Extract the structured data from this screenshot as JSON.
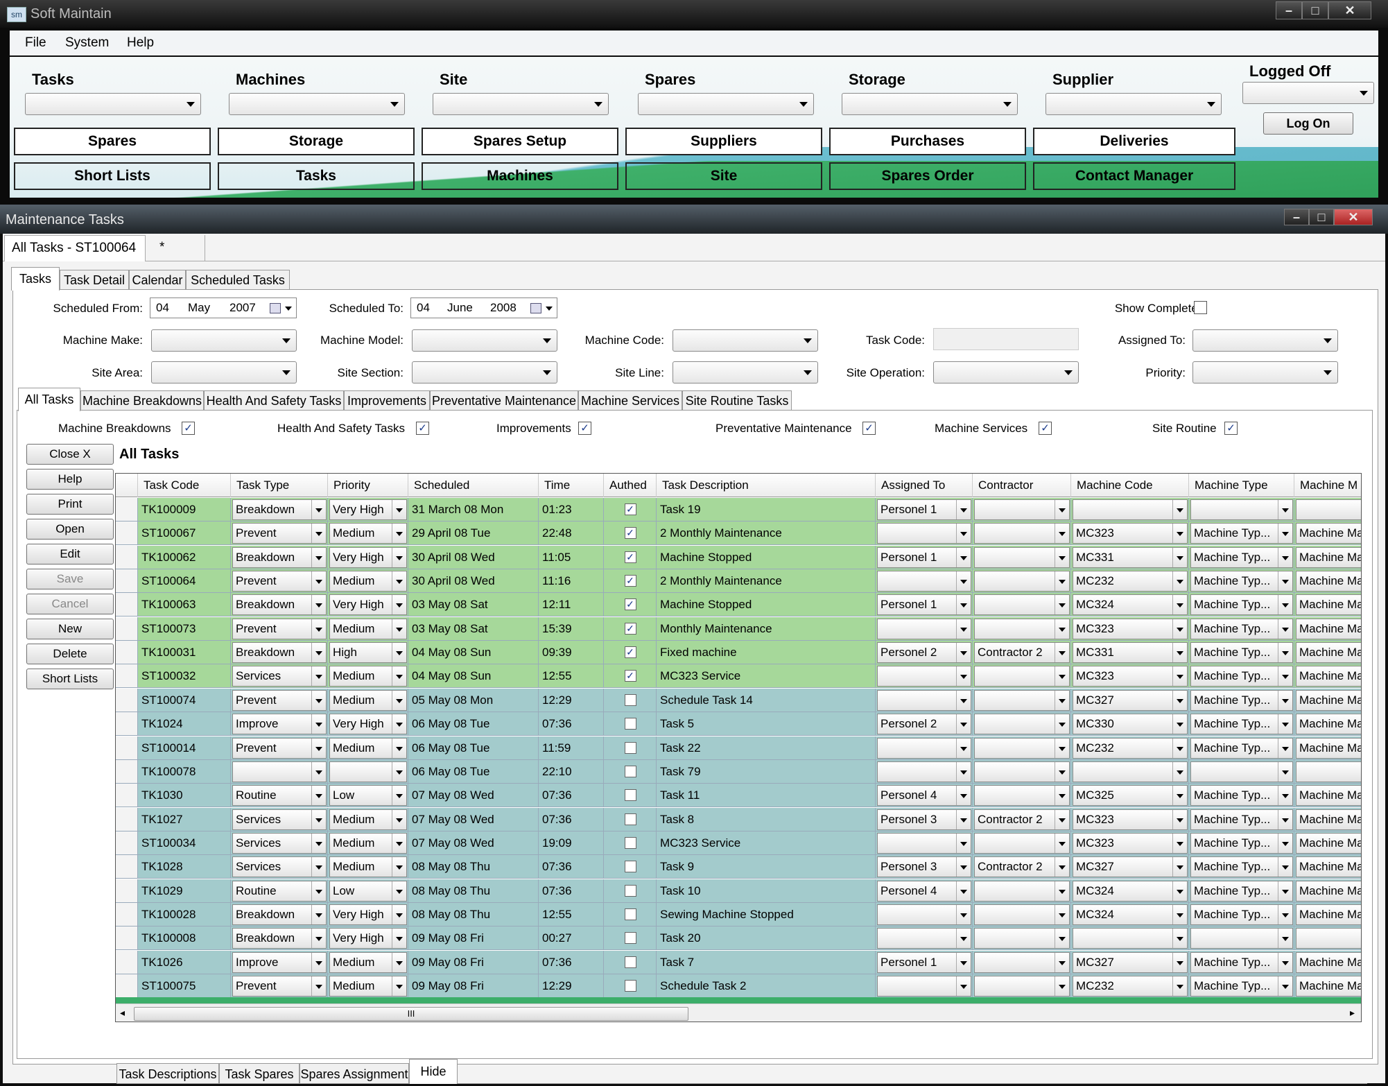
{
  "app": {
    "title": "Soft Maintain",
    "logo_text": "sm"
  },
  "menu": [
    "File",
    "System",
    "Help"
  ],
  "top_dropdowns": [
    {
      "label": "Tasks"
    },
    {
      "label": "Machines"
    },
    {
      "label": "Site"
    },
    {
      "label": "Spares"
    },
    {
      "label": "Storage"
    },
    {
      "label": "Supplier"
    }
  ],
  "login": {
    "status": "Logged Off",
    "button": "Log On"
  },
  "nav_row1": [
    "Spares",
    "Storage",
    "Spares Setup",
    "Suppliers",
    "Purchases",
    "Deliveries"
  ],
  "nav_row2": [
    "Short Lists",
    "Tasks",
    "Machines",
    "Site",
    "Spares Order",
    "Contact Manager"
  ],
  "window": {
    "title": "Maintenance Tasks"
  },
  "doc_tabs": [
    "All Tasks - ST100064",
    "*"
  ],
  "main_tabs": [
    "Tasks",
    "Task Detail",
    "Calendar",
    "Scheduled Tasks"
  ],
  "filters": {
    "scheduled_from": {
      "label": "Scheduled From:",
      "day": "04",
      "month": "May",
      "year": "2007"
    },
    "scheduled_to": {
      "label": "Scheduled To:",
      "day": "04",
      "month": "June",
      "year": "2008"
    },
    "show_completed": "Show Completed:",
    "machine_make": "Machine Make:",
    "machine_model": "Machine Model:",
    "machine_code": "Machine Code:",
    "task_code": "Task Code:",
    "assigned_to": "Assigned To:",
    "site_area": "Site Area:",
    "site_section": "Site Section:",
    "site_line": "Site Line:",
    "site_operation": "Site Operation:",
    "priority": "Priority:"
  },
  "task_tabs": [
    "All Tasks",
    "Machine Breakdowns",
    "Health And Safety Tasks",
    "Improvements",
    "Preventative Maintenance",
    "Machine Services",
    "Site Routine Tasks"
  ],
  "type_checks": [
    "Machine Breakdowns",
    "Health And Safety Tasks",
    "Improvements",
    "Preventative Maintenance",
    "Machine Services",
    "Site Routine"
  ],
  "side_buttons": [
    "Close X",
    "Help",
    "Print",
    "Open",
    "Edit",
    "Save",
    "Cancel",
    "New",
    "Delete",
    "Short Lists"
  ],
  "grid_title": "All Tasks",
  "columns": [
    "Task Code",
    "Task Type",
    "Priority",
    "Scheduled",
    "Time",
    "Authed",
    "Task Description",
    "Assigned To",
    "Contractor",
    "Machine Code",
    "Machine Type",
    "Machine M"
  ],
  "rows": [
    {
      "code": "TK100009",
      "type": "Breakdown",
      "priority": "Very High",
      "scheduled": "31 March 08 Mon",
      "time": "01:23",
      "authed": true,
      "desc": "Task 19",
      "assigned": "Personel 1",
      "contractor": "",
      "mcode": "",
      "mtype": "",
      "mm": "",
      "color": "green"
    },
    {
      "code": "ST100067",
      "type": "Prevent",
      "priority": "Medium",
      "scheduled": "29 April 08 Tue",
      "time": "22:48",
      "authed": true,
      "desc": "2 Monthly Maintenance",
      "assigned": "",
      "contractor": "",
      "mcode": "MC323",
      "mtype": "Machine Typ...",
      "mm": "Machine Ma",
      "color": "green"
    },
    {
      "code": "TK100062",
      "type": "Breakdown",
      "priority": "Very High",
      "scheduled": "30 April 08 Wed",
      "time": "11:05",
      "authed": true,
      "desc": "Machine Stopped",
      "assigned": "Personel 1",
      "contractor": "",
      "mcode": "MC331",
      "mtype": "Machine Typ...",
      "mm": "Machine Ma",
      "color": "green"
    },
    {
      "code": "ST100064",
      "type": "Prevent",
      "priority": "Medium",
      "scheduled": "30 April 08 Wed",
      "time": "11:16",
      "authed": true,
      "desc": "2 Monthly Maintenance",
      "assigned": "",
      "contractor": "",
      "mcode": "MC232",
      "mtype": "Machine Typ...",
      "mm": "Machine Ma",
      "color": "green"
    },
    {
      "code": "TK100063",
      "type": "Breakdown",
      "priority": "Very High",
      "scheduled": "03 May 08 Sat",
      "time": "12:11",
      "authed": true,
      "desc": "Machine Stopped",
      "assigned": "Personel 1",
      "contractor": "",
      "mcode": "MC324",
      "mtype": "Machine Typ...",
      "mm": "Machine Ma",
      "color": "green"
    },
    {
      "code": "ST100073",
      "type": "Prevent",
      "priority": "Medium",
      "scheduled": "03 May 08 Sat",
      "time": "15:39",
      "authed": true,
      "desc": "Monthly Maintenance",
      "assigned": "",
      "contractor": "",
      "mcode": "MC323",
      "mtype": "Machine Typ...",
      "mm": "Machine Ma",
      "color": "green"
    },
    {
      "code": "TK100031",
      "type": "Breakdown",
      "priority": "High",
      "scheduled": "04 May 08 Sun",
      "time": "09:39",
      "authed": true,
      "desc": "Fixed machine",
      "assigned": "Personel 2",
      "contractor": "Contractor 2",
      "mcode": "MC331",
      "mtype": "Machine Typ...",
      "mm": "Machine Ma",
      "color": "green"
    },
    {
      "code": "ST100032",
      "type": "Services",
      "priority": "Medium",
      "scheduled": "04 May 08 Sun",
      "time": "12:55",
      "authed": true,
      "desc": "MC323 Service",
      "assigned": "",
      "contractor": "",
      "mcode": "MC323",
      "mtype": "Machine Typ...",
      "mm": "Machine Ma",
      "color": "green"
    },
    {
      "code": "ST100074",
      "type": "Prevent",
      "priority": "Medium",
      "scheduled": "05 May 08 Mon",
      "time": "12:29",
      "authed": false,
      "desc": "Schedule Task 14",
      "assigned": "",
      "contractor": "",
      "mcode": "MC327",
      "mtype": "Machine Typ...",
      "mm": "Machine Ma",
      "color": "blue"
    },
    {
      "code": "TK1024",
      "type": "Improve",
      "priority": "Very High",
      "scheduled": "06 May 08 Tue",
      "time": "07:36",
      "authed": false,
      "desc": "Task 5",
      "assigned": "Personel 2",
      "contractor": "",
      "mcode": "MC330",
      "mtype": "Machine Typ...",
      "mm": "Machine Ma",
      "color": "blue"
    },
    {
      "code": "ST100014",
      "type": "Prevent",
      "priority": "Medium",
      "scheduled": "06 May 08 Tue",
      "time": "11:59",
      "authed": false,
      "desc": "Task 22",
      "assigned": "",
      "contractor": "",
      "mcode": "MC232",
      "mtype": "Machine Typ...",
      "mm": "Machine Ma",
      "color": "blue"
    },
    {
      "code": "TK100078",
      "type": "",
      "priority": "",
      "scheduled": "06 May 08 Tue",
      "time": "22:10",
      "authed": false,
      "desc": "Task 79",
      "assigned": "",
      "contractor": "",
      "mcode": "",
      "mtype": "",
      "mm": "",
      "color": "blue"
    },
    {
      "code": "TK1030",
      "type": "Routine",
      "priority": "Low",
      "scheduled": "07 May 08 Wed",
      "time": "07:36",
      "authed": false,
      "desc": "Task 11",
      "assigned": "Personel 4",
      "contractor": "",
      "mcode": "MC325",
      "mtype": "Machine Typ...",
      "mm": "Machine Ma",
      "color": "blue"
    },
    {
      "code": "TK1027",
      "type": "Services",
      "priority": "Medium",
      "scheduled": "07 May 08 Wed",
      "time": "07:36",
      "authed": false,
      "desc": "Task 8",
      "assigned": "Personel 3",
      "contractor": "Contractor 2",
      "mcode": "MC323",
      "mtype": "Machine Typ...",
      "mm": "Machine Ma",
      "color": "blue"
    },
    {
      "code": "ST100034",
      "type": "Services",
      "priority": "Medium",
      "scheduled": "07 May 08 Wed",
      "time": "19:09",
      "authed": false,
      "desc": "MC323 Service",
      "assigned": "",
      "contractor": "",
      "mcode": "MC323",
      "mtype": "Machine Typ...",
      "mm": "Machine Ma",
      "color": "blue"
    },
    {
      "code": "TK1028",
      "type": "Services",
      "priority": "Medium",
      "scheduled": "08 May 08 Thu",
      "time": "07:36",
      "authed": false,
      "desc": "Task 9",
      "assigned": "Personel 3",
      "contractor": "Contractor 2",
      "mcode": "MC327",
      "mtype": "Machine Typ...",
      "mm": "Machine Ma",
      "color": "blue"
    },
    {
      "code": "TK1029",
      "type": "Routine",
      "priority": "Low",
      "scheduled": "08 May 08 Thu",
      "time": "07:36",
      "authed": false,
      "desc": "Task 10",
      "assigned": "Personel 4",
      "contractor": "",
      "mcode": "MC324",
      "mtype": "Machine Typ...",
      "mm": "Machine Ma",
      "color": "blue"
    },
    {
      "code": "TK100028",
      "type": "Breakdown",
      "priority": "Very High",
      "scheduled": "08 May 08 Thu",
      "time": "12:55",
      "authed": false,
      "desc": "Sewing Machine Stopped",
      "assigned": "",
      "contractor": "",
      "mcode": "MC324",
      "mtype": "Machine Typ...",
      "mm": "Machine Ma",
      "color": "blue"
    },
    {
      "code": "TK100008",
      "type": "Breakdown",
      "priority": "Very High",
      "scheduled": "09 May 08 Fri",
      "time": "00:27",
      "authed": false,
      "desc": "Task 20",
      "assigned": "",
      "contractor": "",
      "mcode": "",
      "mtype": "",
      "mm": "",
      "color": "blue"
    },
    {
      "code": "TK1026",
      "type": "Improve",
      "priority": "Medium",
      "scheduled": "09 May 08 Fri",
      "time": "07:36",
      "authed": false,
      "desc": "Task 7",
      "assigned": "Personel 1",
      "contractor": "",
      "mcode": "MC327",
      "mtype": "Machine Typ...",
      "mm": "Machine Ma",
      "color": "blue"
    },
    {
      "code": "ST100075",
      "type": "Prevent",
      "priority": "Medium",
      "scheduled": "09 May 08 Fri",
      "time": "12:29",
      "authed": false,
      "desc": "Schedule Task 2",
      "assigned": "",
      "contractor": "",
      "mcode": "MC232",
      "mtype": "Machine Typ...",
      "mm": "Machine Ma",
      "color": "blue"
    }
  ],
  "row_colors": {
    "green": "#a6d89a",
    "blue": "#a3cbcc"
  },
  "scroll_thumb": "III",
  "bottom_tabs": [
    "Task Descriptions",
    "Task Spares",
    "Spares Assignment",
    "Hide"
  ]
}
